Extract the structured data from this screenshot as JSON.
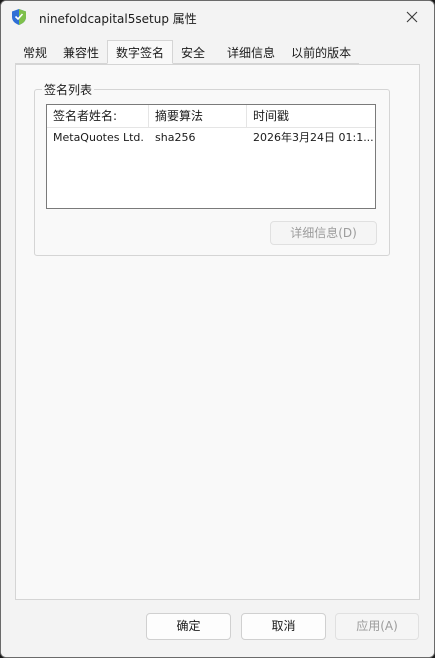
{
  "window": {
    "title": "ninefoldcapital5setup 属性"
  },
  "tabs": [
    {
      "label": "常规"
    },
    {
      "label": "兼容性"
    },
    {
      "label": "数字签名"
    },
    {
      "label": "安全"
    },
    {
      "label": "详细信息"
    },
    {
      "label": "以前的版本"
    }
  ],
  "active_tab": "数字签名",
  "signature_list": {
    "group_label": "签名列表",
    "columns": [
      "签名者姓名:",
      "摘要算法",
      "时间戳"
    ],
    "rows": [
      {
        "signer": "MetaQuotes Ltd.",
        "digest": "sha256",
        "timestamp": "2026年3月24日 01:1..."
      }
    ],
    "details_button": "详细信息(D)"
  },
  "footer": {
    "ok": "确定",
    "cancel": "取消",
    "apply": "应用(A)"
  },
  "colors": {
    "window_bg": "#f3f3f3",
    "panel_bg": "#f9f9f9",
    "border": "#d5d5d5",
    "disabled_text": "#9c9c9c"
  },
  "icons": {
    "app": "installer-shield-icon",
    "close": "close-icon"
  }
}
